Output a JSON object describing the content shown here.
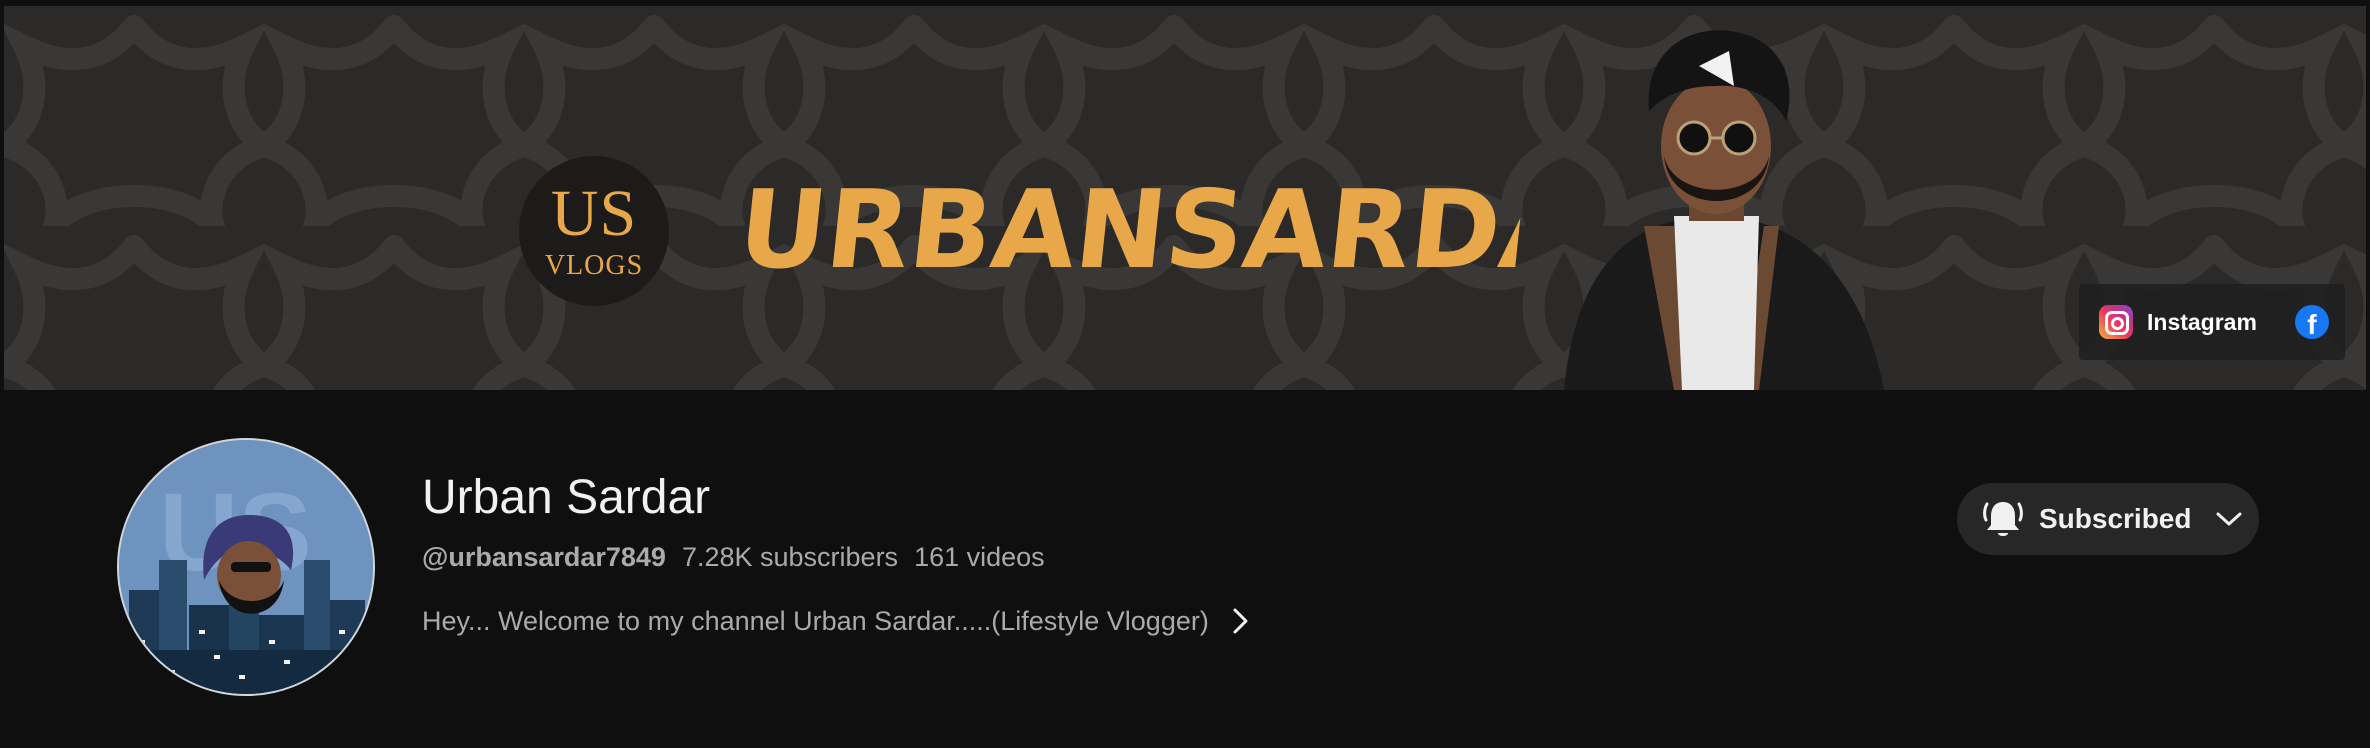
{
  "banner": {
    "logo_main": "US",
    "logo_sub": "VLOGS",
    "wordmark": "URBANSARDAR",
    "links": [
      {
        "label": "Instagram",
        "icon": "instagram-icon"
      },
      {
        "label": "",
        "icon": "facebook-icon"
      }
    ],
    "accent_color": "#e8a84a"
  },
  "channel": {
    "name": "Urban Sardar",
    "handle": "@urbansardar7849",
    "subscribers": "7.28K subscribers",
    "videos": "161 videos",
    "description": "Hey... Welcome to my channel Urban Sardar.....(Lifestyle Vlogger)",
    "avatar_icon": "channel-avatar"
  },
  "subscribe": {
    "label": "Subscribed",
    "bell_icon": "bell-icon",
    "dropdown_icon": "chevron-down-icon"
  }
}
